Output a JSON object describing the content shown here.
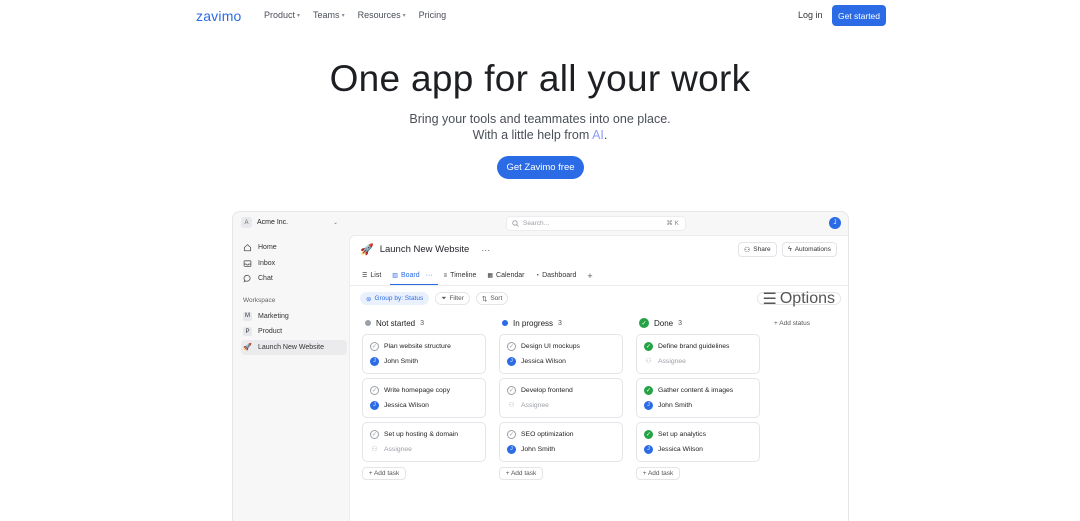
{
  "nav": {
    "brand": "zavimo",
    "menu": [
      {
        "label": "Product",
        "caret": true
      },
      {
        "label": "Teams",
        "caret": true
      },
      {
        "label": "Resources",
        "caret": true
      },
      {
        "label": "Pricing",
        "caret": false
      }
    ],
    "login": "Log in",
    "cta": "Get started"
  },
  "hero": {
    "title": "One app for all your work",
    "line1": "Bring your tools and teammates into one place.",
    "line2_prefix": "With a little help from ",
    "line2_ai": "AI",
    "line2_suffix": ".",
    "cta": "Get Zavimo free"
  },
  "app": {
    "workspace": {
      "initial": "A",
      "name": "Acme Inc."
    },
    "search": {
      "placeholder": "Search...",
      "shortcut": "⌘ K"
    },
    "user_initial": "J",
    "sidebar": {
      "items": [
        {
          "label": "Home",
          "icon": "home-icon"
        },
        {
          "label": "Inbox",
          "icon": "inbox-icon"
        },
        {
          "label": "Chat",
          "icon": "chat-icon"
        }
      ],
      "section": "Workspace",
      "spaces": [
        {
          "chip": "M",
          "label": "Marketing"
        },
        {
          "chip": "P",
          "label": "Product"
        },
        {
          "chip": "🚀",
          "label": "Launch New Website"
        }
      ]
    },
    "page": {
      "title": "Launch New Website",
      "more": "···",
      "share": "Share",
      "automations": "Automations"
    },
    "tabs": [
      {
        "label": "List",
        "icon": "☰"
      },
      {
        "label": "Board",
        "icon": "▥",
        "extra": "···"
      },
      {
        "label": "Timeline",
        "icon": "≡"
      },
      {
        "label": "Calendar",
        "icon": "▦"
      },
      {
        "label": "Dashboard",
        "icon": "◔"
      }
    ],
    "add_tab": "+",
    "filters": {
      "group": "Group by: Status",
      "filter": "Filter",
      "sort": "Sort",
      "options": "Options"
    },
    "columns": [
      {
        "name": "Not started",
        "count": "3",
        "color": "#9aa0a8",
        "cards": [
          {
            "title": "Plan website structure",
            "assignee": "John Smith",
            "initial": "J",
            "done": false
          },
          {
            "title": "Write homepage copy",
            "assignee": "Jessica Wilson",
            "initial": "J",
            "done": false
          },
          {
            "title": "Set up hosting & domain",
            "assignee": "Assignee",
            "initial": "",
            "done": false
          }
        ]
      },
      {
        "name": "In progress",
        "count": "3",
        "color": "#2b6be6",
        "cards": [
          {
            "title": "Design UI mockups",
            "assignee": "Jessica Wilson",
            "initial": "J",
            "done": false
          },
          {
            "title": "Develop frontend",
            "assignee": "Assignee",
            "initial": "",
            "done": false
          },
          {
            "title": "SEO optimization",
            "assignee": "John Smith",
            "initial": "J",
            "done": false
          }
        ]
      },
      {
        "name": "Done",
        "count": "3",
        "color": "#25a244",
        "cards": [
          {
            "title": "Define brand guidelines",
            "assignee": "Assignee",
            "initial": "",
            "done": true
          },
          {
            "title": "Gather content & images",
            "assignee": "John Smith",
            "initial": "J",
            "done": true
          },
          {
            "title": "Set up analytics",
            "assignee": "Jessica Wilson",
            "initial": "J",
            "done": true
          }
        ]
      }
    ],
    "add_task": "+ Add task",
    "add_status": "+ Add status"
  }
}
